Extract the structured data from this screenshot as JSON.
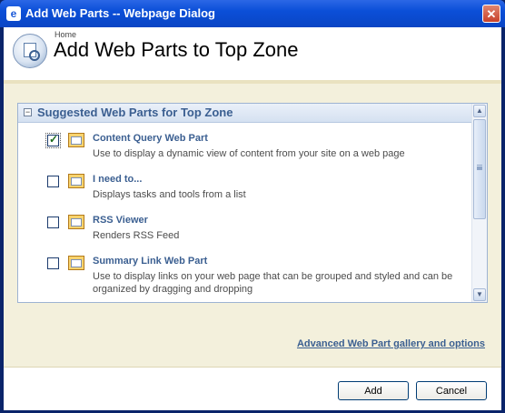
{
  "window": {
    "title": "Add Web Parts -- Webpage Dialog",
    "title_icon": "e",
    "close_glyph": "✕"
  },
  "header": {
    "breadcrumb": "Home",
    "title": "Add Web Parts to Top Zone"
  },
  "list": {
    "header": "Suggested Web Parts for Top Zone",
    "collapse_glyph": "−",
    "items": [
      {
        "title": "Content Query Web Part",
        "description": "Use to display a dynamic view of content from your site on a web page",
        "checked": true
      },
      {
        "title": "I need to...",
        "description": "Displays tasks and tools from a list",
        "checked": false
      },
      {
        "title": "RSS Viewer",
        "description": "Renders RSS Feed",
        "checked": false
      },
      {
        "title": "Summary Link Web Part",
        "description": "Use to display links on your web page that can be grouped and styled and can be organized by dragging and dropping",
        "checked": false
      }
    ],
    "check_glyph": "✓",
    "scroll_up_glyph": "▲",
    "scroll_down_glyph": "▼"
  },
  "links": {
    "gallery": "Advanced Web Part gallery and options"
  },
  "footer": {
    "add_label": "Add",
    "cancel_label": "Cancel"
  }
}
